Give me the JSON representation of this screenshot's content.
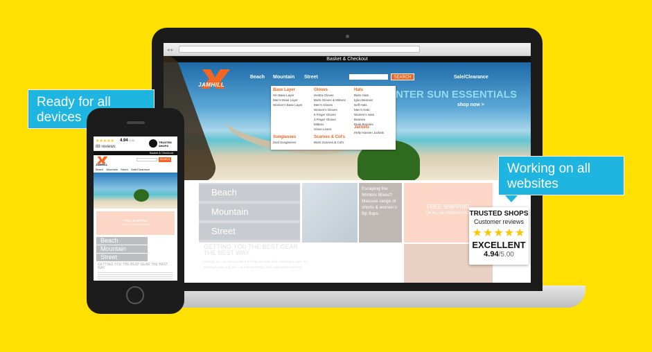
{
  "callouts": {
    "left": "Ready for all devices",
    "right": "Working on all websites"
  },
  "laptop_site": {
    "top_bar": "Basket & Checkout",
    "logo_text": "JAMHILL",
    "nav": [
      "Beach",
      "Mountain",
      "Street"
    ],
    "search_label": "SEARCH",
    "sale_link": "Sale/Clearance",
    "hero_headline": "NTER SUN ESSENTIALS",
    "hero_link": "shop now >",
    "dropdown": {
      "col1": [
        {
          "title": "Base Layer",
          "items": [
            "HH Base Layer",
            "Men's Base Layer",
            "Women's Base Layer"
          ]
        },
        {
          "title": "Sunglasses",
          "items": [
            "Zeal Sunglasses"
          ]
        }
      ],
      "col2": [
        {
          "title": "Gloves",
          "items": [
            "Hestra Gloves",
            "Barts Gloves & Mittens",
            "Men's Gloves",
            "Women's Gloves",
            "5 Finger Gloves",
            "3 Finger Gloves",
            "Mittens",
            "Glove Liners"
          ]
        },
        {
          "title": "Scarves & Col's",
          "items": [
            "Barts Scarves & Col's"
          ]
        }
      ],
      "col3": [
        {
          "title": "Hats",
          "items": [
            "Barts Hats",
            "Igloo Beanies",
            "Neff Hats",
            "Men's Hats",
            "Women's Hats",
            "Beanies",
            "Peak Beanies"
          ]
        },
        {
          "title": "Jackets",
          "items": [
            "Helly Hansen Jackets"
          ]
        }
      ]
    },
    "categories": [
      "Beach",
      "Mountain",
      "Street"
    ],
    "promo_text": "Escaping the Winters Blues? Massive range of shorts & women's flip flops",
    "free_shipping_title": "FREE SHIPPING",
    "free_shipping_sub": "ON ALL UK ORDERS OVER",
    "getting_heading": "GETTING YOU THE BEST GEAR THE BEST WAY",
    "body_text": "Used by us - we only provide the things we have tried, tested and used. So whilst you may only see 1 or a dozen things, hope you can be sure that"
  },
  "trusted_shops_badge": {
    "title": "TRUSTED SHOPS",
    "subtitle": "Customer reviews",
    "stars": "★★★★★",
    "rating_word": "EXCELLENT",
    "score": "4.94",
    "score_max": "/5.00"
  },
  "phone_site": {
    "stars": "★★★★★",
    "score": "4.94",
    "score_max": "5.00",
    "reviews": "88 reviews",
    "ts_logo_text": "TRUSTED SHOPS",
    "top_bar": "Basket & Checkout",
    "logo_text": "JAMHILL",
    "search_label": "SEARCH",
    "nav": [
      "Beach",
      "Mountain",
      "Street",
      "Sale/Clearance"
    ],
    "free_shipping_title": "FREE SHIPPING",
    "free_shipping_sub": "ON ALL UK ORDERS OVER",
    "categories": [
      "Beach",
      "Mountain",
      "Street"
    ],
    "getting_heading": "GETTING YOU THE BEST GEAR THE BEST WAY"
  },
  "colors": {
    "background": "#FFE000",
    "callout": "#1eb6e0",
    "accent_orange": "#f26522",
    "star_gold": "#FFC400",
    "promo_pink": "#fcd7c8"
  }
}
